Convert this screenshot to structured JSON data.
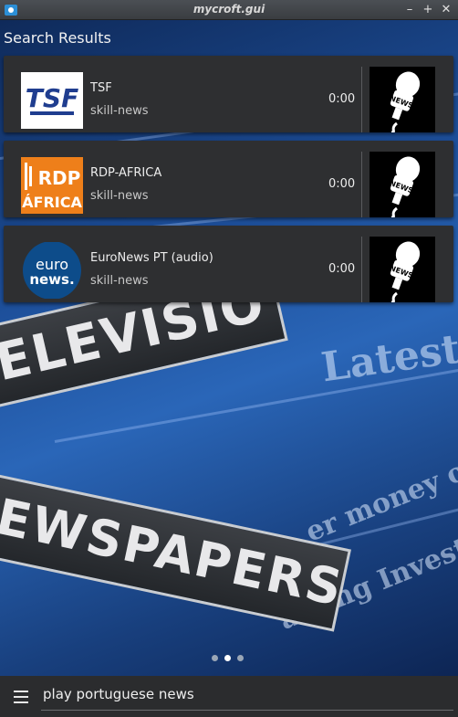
{
  "window": {
    "title": "mycroft.gui",
    "controls": [
      "–",
      "+",
      "✕"
    ]
  },
  "header": {
    "title": "Search Results"
  },
  "results": [
    {
      "name": "TSF",
      "skill": "skill-news",
      "duration": "0:00",
      "logo": "tsf-logo",
      "logo_text": "TSF"
    },
    {
      "name": "RDP-AFRICA",
      "skill": "skill-news",
      "duration": "0:00",
      "logo": "rdp-africa-logo",
      "logo_text": "RDP"
    },
    {
      "name": "EuroNews PT (audio)",
      "skill": "skill-news",
      "duration": "0:00",
      "logo": "euronews-logo",
      "logo_text": "euro"
    }
  ],
  "background_text": {
    "sign1": "ELEVISIO",
    "sign2": "EWSPAPERS",
    "latest": "Latest",
    "money": "er money o",
    "invest": "acting Invest"
  },
  "pager": {
    "count": 3,
    "active": 1
  },
  "input": {
    "query": "play portuguese news"
  },
  "colors": {
    "card_bg": "#2e2f31",
    "bottom_bar": "#2b2c2e",
    "rdp_orange": "#ee7f1a",
    "euronews_blue": "#0d4c8a",
    "tsf_blue": "#1f3d8f"
  }
}
